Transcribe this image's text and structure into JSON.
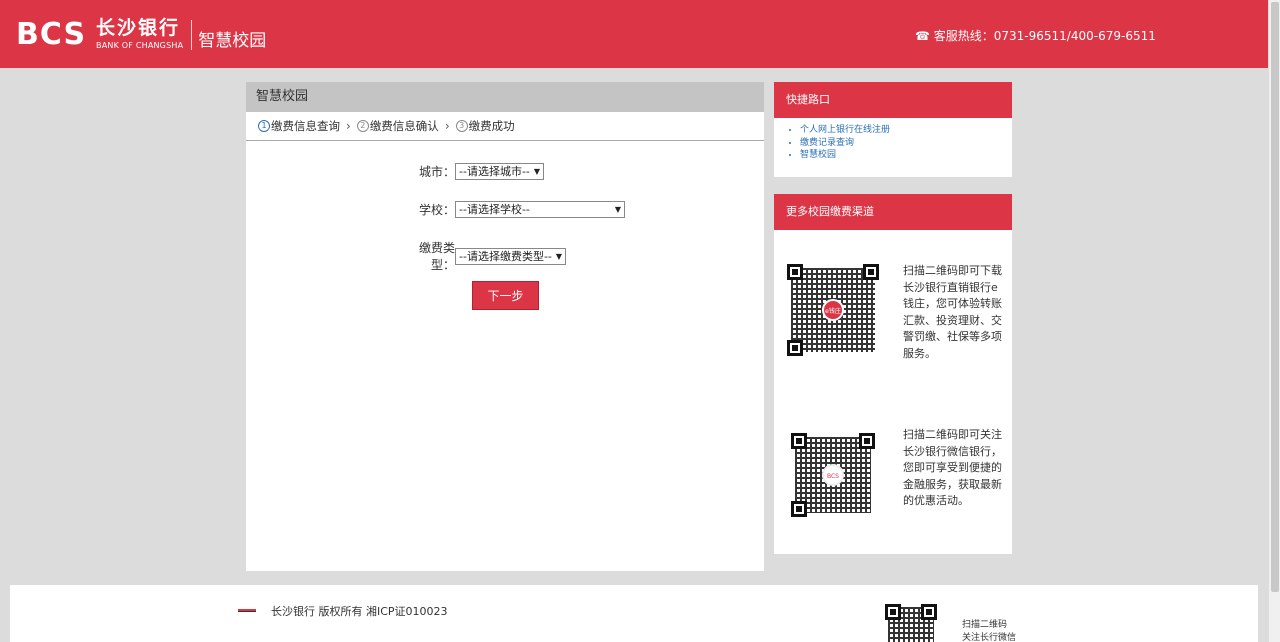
{
  "header": {
    "logo_mark": "BCS",
    "bank_name_cn": "长沙银行",
    "bank_name_en": "BANK OF CHANGSHA",
    "product_name": "智慧校园",
    "hotline": "☎ 客服热线：0731-96511/400-679-6511"
  },
  "main": {
    "title": "智慧校园",
    "steps": [
      {
        "num": "1",
        "label": "缴费信息查询"
      },
      {
        "num": "2",
        "label": "缴费信息确认"
      },
      {
        "num": "3",
        "label": "缴费成功"
      }
    ],
    "form": {
      "city_label": "城市：",
      "city_value": "--请选择城市--",
      "school_label": "学校：",
      "school_value": "--请选择学校--",
      "fee_type_label": "缴费类型：",
      "fee_type_value": "--请选择缴费类型--",
      "next_button": "下一步"
    }
  },
  "sidebar": {
    "quick_title": "快捷路口",
    "quick_links": [
      "个人网上银行在线注册",
      "缴费记录查询",
      "智慧校园"
    ],
    "channels_title": "更多校园缴费渠道",
    "qr1_text": "扫描二维码即可下载长沙银行直销银行e钱庄，您可体验转账汇款、投资理财、交警罚缴、社保等多项服务。",
    "qr2_text": "扫描二维码即可关注长沙银行微信银行，您即可享受到便捷的金融服务，获取最新的优惠活动。",
    "qr1_logo": "e钱庄",
    "qr2_logo": "BCS"
  },
  "footer": {
    "copyright": "长沙银行 版权所有 湘ICP证010023",
    "scan_text_1": "扫描二维码",
    "scan_text_2": "关注长行微信"
  },
  "colors": {
    "brand_red": "#dc3546",
    "link_blue": "#2a6fb5"
  }
}
